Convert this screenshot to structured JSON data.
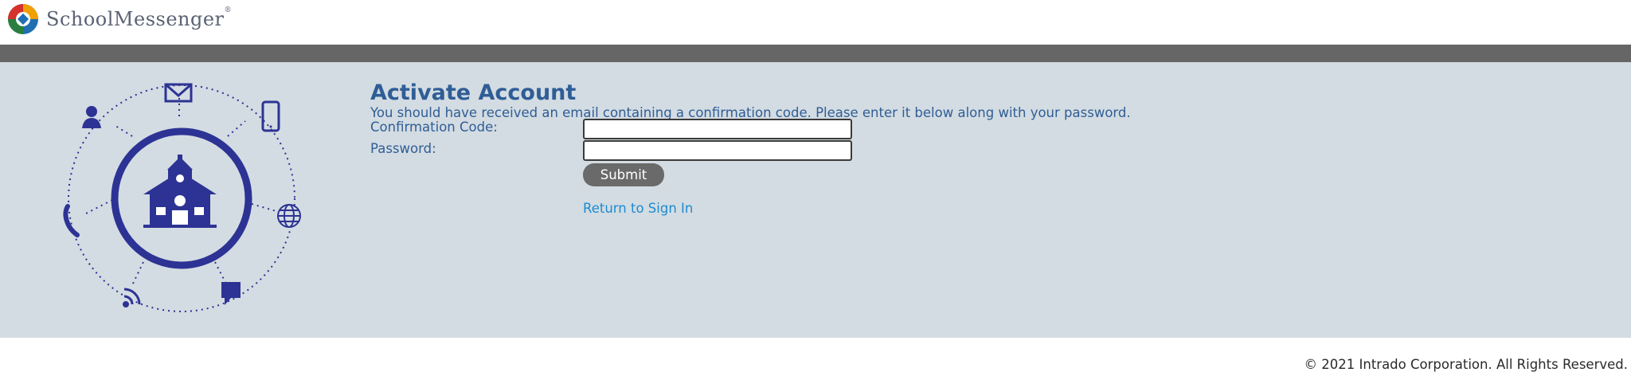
{
  "header": {
    "brand": "SchoolMessenger",
    "registered": "®"
  },
  "activate": {
    "title": "Activate Account",
    "instructions": "You should have received an email containing a confirmation code. Please enter it below along with your password.",
    "confirmation_label": "Confirmation Code:",
    "confirmation_value": "",
    "password_label": "Password:",
    "password_value": "",
    "submit_label": "Submit",
    "return_link": "Return to Sign In"
  },
  "footer": {
    "copyright": "© 2021 Intrado Corporation. All Rights Reserved."
  },
  "colors": {
    "panel_bg": "#d3dce2",
    "bar": "#666666",
    "title": "#2f5d96",
    "link": "#1d8bd0",
    "illustration": "#2d3394",
    "button": "#6b6a6a"
  },
  "illustration_icons": [
    "schoolhouse-icon",
    "envelope-icon",
    "mobile-phone-icon",
    "globe-icon",
    "chat-bubble-icon",
    "rss-icon",
    "telephone-icon",
    "user-icon"
  ]
}
